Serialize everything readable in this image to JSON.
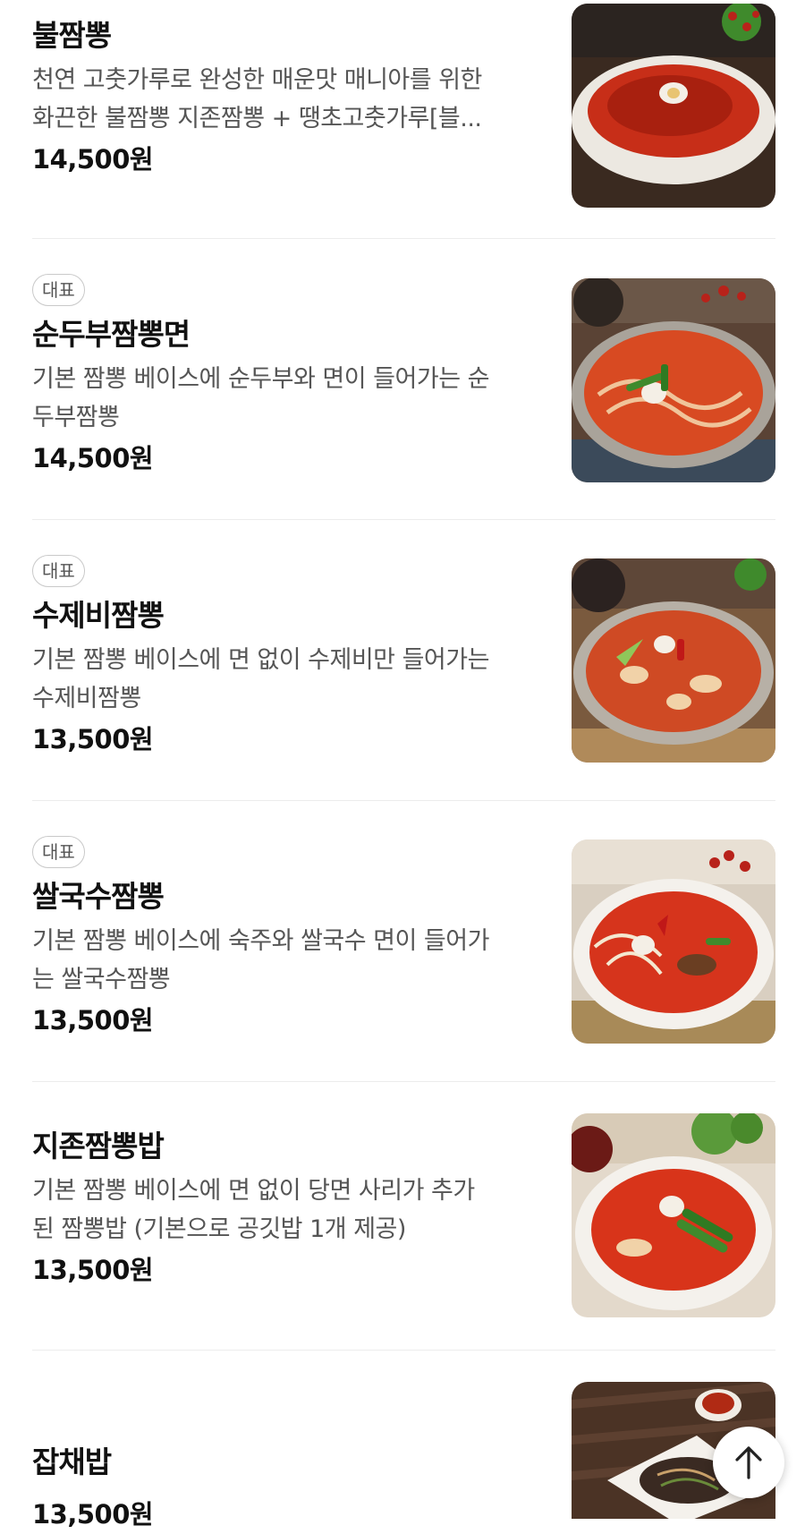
{
  "menu": {
    "items": [
      {
        "badge": "",
        "name": "불짬뽕",
        "desc_line1": "천연 고춧가루로 완성한 매운맛 매니아를 위한",
        "desc_line2": "화끈한 불짬뽕 지존짬뽕 + 땡초고춧가루[블...",
        "price": "14,500원",
        "image_icon": "spicy-soup-bowl-photo"
      },
      {
        "badge": "대표",
        "name": "순두부짬뽕면",
        "desc_line1": "기본 짬뽕 베이스에 순두부와 면이 들어가는 순",
        "desc_line2": "두부짬뽕",
        "price": "14,500원",
        "image_icon": "noodle-pot-photo"
      },
      {
        "badge": "대표",
        "name": "수제비짬뽕",
        "desc_line1": "기본 짬뽕 베이스에 면 없이 수제비만 들어가는",
        "desc_line2": "수제비짬뽕",
        "price": "13,500원",
        "image_icon": "sujebi-pot-photo"
      },
      {
        "badge": "대표",
        "name": "쌀국수짬뽕",
        "desc_line1": "기본 짬뽕 베이스에 숙주와 쌀국수 면이 들어가",
        "desc_line2": "는 쌀국수짬뽕",
        "price": "13,500원",
        "image_icon": "rice-noodle-bowl-photo"
      },
      {
        "badge": "",
        "name": "지존짬뽕밥",
        "desc_line1": "기본 짬뽕 베이스에 면 없이 당면 사리가 추가",
        "desc_line2": "된 짬뽕밥 (기본으로 공깃밥 1개 제공)",
        "price": "13,500원",
        "image_icon": "jjambbong-rice-bowl-photo"
      },
      {
        "badge": "",
        "name": "잡채밥",
        "desc_line1": "",
        "desc_line2": "",
        "price": "13,500원",
        "image_icon": "japchae-plate-photo"
      }
    ]
  },
  "colors": {
    "soup_red": "#d3301a",
    "bowl_white": "#f4f1ec",
    "wood_dark": "#4a2e1f",
    "garnish_green": "#3f8a2c"
  },
  "scroll_top": {
    "icon": "arrow-up-icon"
  }
}
